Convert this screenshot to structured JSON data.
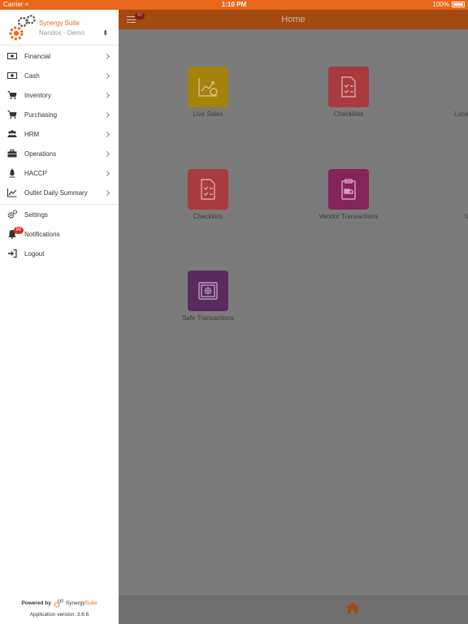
{
  "status_bar": {
    "carrier": "Carrier",
    "time": "1:10 PM",
    "battery": "100%"
  },
  "nav": {
    "title": "Home",
    "badge": "90"
  },
  "tiles": [
    {
      "label": "Live Sales",
      "color": "#a4820b",
      "icon": "chart-icon"
    },
    {
      "label": "Checklists",
      "color": "#a83a40",
      "icon": "checklist-icon"
    },
    {
      "label": "Loca",
      "color": "#7b7b7b",
      "icon": ""
    },
    {
      "label": "Checklists",
      "color": "#a83a40",
      "icon": "checklist-icon"
    },
    {
      "label": "Vendor Transactions",
      "color": "#84245a",
      "icon": "clipboard-truck-icon"
    },
    {
      "label": "In",
      "color": "#7b7b7b",
      "icon": ""
    },
    {
      "label": "Safe Transactions",
      "color": "#5a2a5e",
      "icon": "safe-icon"
    }
  ],
  "drawer": {
    "brand": "Synergy Suite",
    "organization": "Nandos - Demo",
    "menu": [
      {
        "label": "Financial",
        "icon": "money-icon"
      },
      {
        "label": "Cash",
        "icon": "money-icon"
      },
      {
        "label": "Inventory",
        "icon": "cart-icon"
      },
      {
        "label": "Purchasing",
        "icon": "cart-icon"
      },
      {
        "label": "HRM",
        "icon": "users-icon"
      },
      {
        "label": "Operations",
        "icon": "briefcase-icon"
      },
      {
        "label": "HACCP",
        "icon": "thermometer-icon"
      },
      {
        "label": "Outlet Daily Summary",
        "icon": "line-chart-icon"
      }
    ],
    "settings": "Settings",
    "notifications": "Notifications",
    "notifications_badge": "90",
    "logout": "Logout",
    "footer": {
      "powered_by": "Powered by",
      "brand_a": "Synergy",
      "brand_b": "Suite",
      "version": "Application version: 3.6.6"
    }
  },
  "colors": {
    "accent": "#e9671b",
    "badge": "#d9302a"
  }
}
